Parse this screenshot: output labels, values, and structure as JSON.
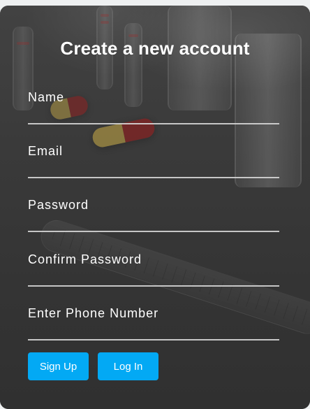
{
  "form": {
    "title": "Create a new account",
    "fields": [
      {
        "label": "Name",
        "value": ""
      },
      {
        "label": "Email",
        "value": ""
      },
      {
        "label": "Password",
        "value": ""
      },
      {
        "label": "Confirm Password",
        "value": ""
      },
      {
        "label": "Enter Phone Number",
        "value": ""
      }
    ],
    "buttons": {
      "signup": "Sign Up",
      "login": "Log In"
    },
    "colors": {
      "button": "#03a9f4",
      "text": "#ffffff",
      "underline": "#d6d6d6"
    }
  }
}
